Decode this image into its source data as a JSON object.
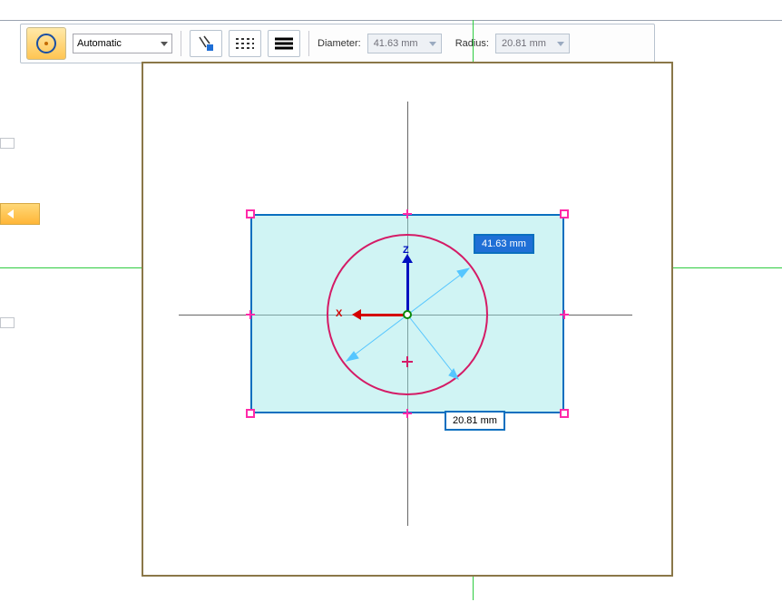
{
  "toolbar": {
    "style": "Automatic",
    "diameter_label": "Diameter:",
    "diameter_value": "41.63 mm",
    "radius_label": "Radius:",
    "radius_value": "20.81 mm"
  },
  "canvas": {
    "diameter_readout": "41.63 mm",
    "radius_readout": "20.81 mm",
    "axis_x": "X",
    "axis_z": "Z"
  }
}
